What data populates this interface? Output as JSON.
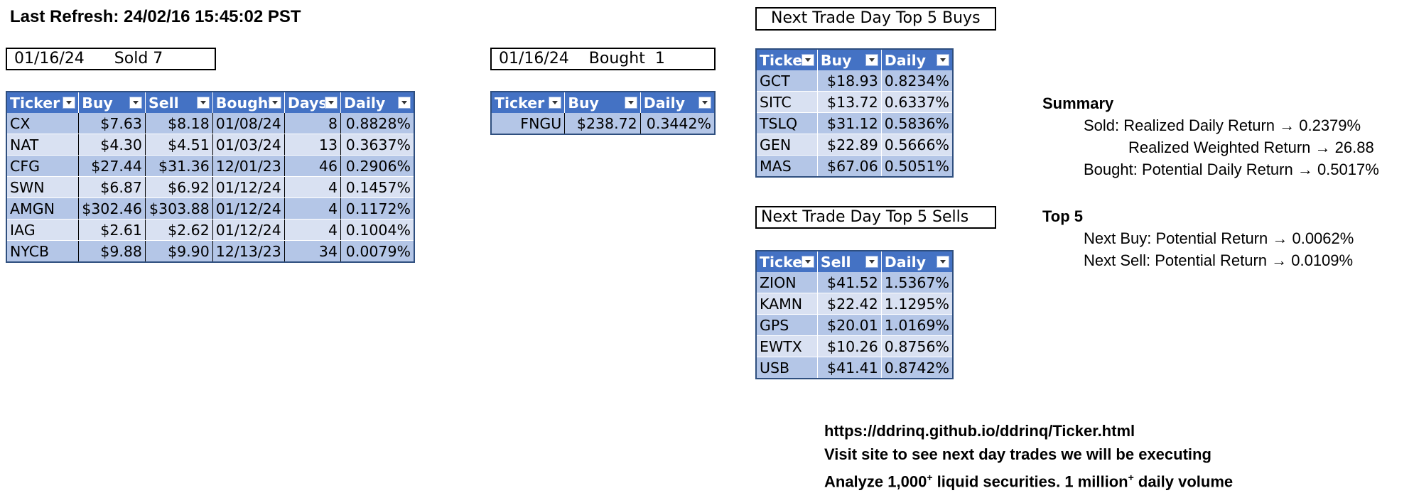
{
  "refresh": "Last Refresh: 24/02/16 15:45:02 PST",
  "sold_box": {
    "date": "01/16/24",
    "label": "Sold",
    "count": "7"
  },
  "bought_box": {
    "date": "01/16/24",
    "label": "Bought",
    "count": "1"
  },
  "buys_title": "Next Trade Day Top 5 Buys",
  "sells_title": "Next Trade Day Top 5 Sells",
  "sold_table": {
    "headers": [
      "Ticker",
      "Buy",
      "Sell",
      "Bought",
      "Days",
      "Daily"
    ],
    "rows": [
      [
        "CX",
        "$7.63",
        "$8.18",
        "01/08/24",
        "8",
        "0.8828%"
      ],
      [
        "NAT",
        "$4.30",
        "$4.51",
        "01/03/24",
        "13",
        "0.3637%"
      ],
      [
        "CFG",
        "$27.44",
        "$31.36",
        "12/01/23",
        "46",
        "0.2906%"
      ],
      [
        "SWN",
        "$6.87",
        "$6.92",
        "01/12/24",
        "4",
        "0.1457%"
      ],
      [
        "AMGN",
        "$302.46",
        "$303.88",
        "01/12/24",
        "4",
        "0.1172%"
      ],
      [
        "IAG",
        "$2.61",
        "$2.62",
        "01/12/24",
        "4",
        "0.1004%"
      ],
      [
        "NYCB",
        "$9.88",
        "$9.90",
        "12/13/23",
        "34",
        "0.0079%"
      ]
    ]
  },
  "bought_table": {
    "headers": [
      "Ticker",
      "Buy",
      "Daily"
    ],
    "rows": [
      [
        "FNGU",
        "$238.72",
        "0.3442%"
      ]
    ]
  },
  "buys_table": {
    "headers": [
      "Ticker",
      "Buy",
      "Daily"
    ],
    "rows": [
      [
        "GCT",
        "$18.93",
        "0.8234%"
      ],
      [
        "SITC",
        "$13.72",
        "0.6337%"
      ],
      [
        "TSLQ",
        "$31.12",
        "0.5836%"
      ],
      [
        "GEN",
        "$22.89",
        "0.5666%"
      ],
      [
        "MAS",
        "$67.06",
        "0.5051%"
      ]
    ]
  },
  "sells_table": {
    "headers": [
      "Ticker",
      "Sell",
      "Daily"
    ],
    "rows": [
      [
        "ZION",
        "$41.52",
        "1.5367%"
      ],
      [
        "KAMN",
        "$22.42",
        "1.1295%"
      ],
      [
        "GPS",
        "$20.01",
        "1.0169%"
      ],
      [
        "EWTX",
        "$10.26",
        "0.8756%"
      ],
      [
        "USB",
        "$41.41",
        "0.8742%"
      ]
    ]
  },
  "summary": {
    "title": "Summary",
    "sold_line": "Sold: Realized Daily Return → 0.2379%",
    "weighted_line": "Realized Weighted Return → 26.88",
    "bought_line": "Bought: Potential Daily Return → 0.5017%"
  },
  "top5": {
    "title": "Top 5",
    "buy_line": "Next Buy: Potential Return → 0.0062%",
    "sell_line": "Next Sell: Potential Return → 0.0109%"
  },
  "footer": {
    "url": "https://ddrinq.github.io/ddrinq/Ticker.html",
    "visit": "Visit site to see next day trades we will be executing",
    "analyze_a": "Analyze 1,000",
    "analyze_sup1": "+",
    "analyze_b": " liquid securities.  1 million",
    "analyze_sup2": "+",
    "analyze_c": " daily volume"
  },
  "colors": {
    "header": "#4472c4",
    "band_dark": "#b4c6e7",
    "band_light": "#d9e1f2"
  }
}
